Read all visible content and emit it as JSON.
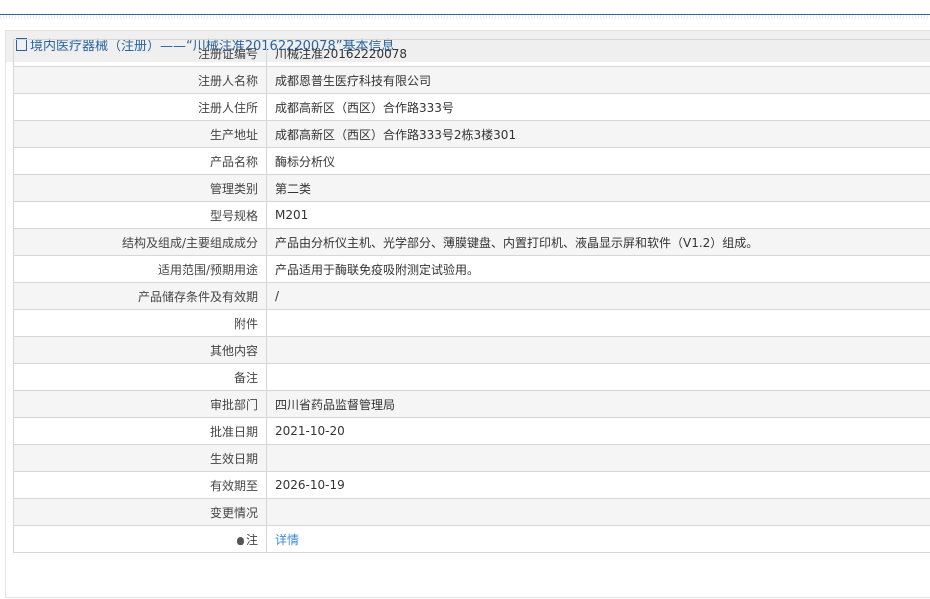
{
  "title": "境内医疗器械（注册）——“川械注准20162220078”基本信息",
  "rows": [
    {
      "label": "注册证编号",
      "value": "川械注准20162220078"
    },
    {
      "label": "注册人名称",
      "value": "成都恩普生医疗科技有限公司"
    },
    {
      "label": "注册人住所",
      "value": "成都高新区（西区）合作路333号"
    },
    {
      "label": "生产地址",
      "value": "成都高新区（西区）合作路333号2栋3楼301"
    },
    {
      "label": "产品名称",
      "value": "酶标分析仪"
    },
    {
      "label": "管理类别",
      "value": "第二类"
    },
    {
      "label": "型号规格",
      "value": "M201"
    },
    {
      "label": "结构及组成/主要组成成分",
      "value": "产品由分析仪主机、光学部分、薄膜键盘、内置打印机、液晶显示屏和软件（V1.2）组成。"
    },
    {
      "label": "适用范围/预期用途",
      "value": "产品适用于酶联免疫吸附测定试验用。"
    },
    {
      "label": "产品储存条件及有效期",
      "value": "/"
    },
    {
      "label": "附件",
      "value": ""
    },
    {
      "label": "其他内容",
      "value": ""
    },
    {
      "label": "备注",
      "value": ""
    },
    {
      "label": "审批部门",
      "value": "四川省药品监督管理局"
    },
    {
      "label": "批准日期",
      "value": "2021-10-20"
    },
    {
      "label": "生效日期",
      "value": ""
    },
    {
      "label": "有效期至",
      "value": "2026-10-19"
    },
    {
      "label": "变更情况",
      "value": ""
    }
  ],
  "note": {
    "label": "注",
    "link": "详情"
  },
  "colors": {
    "accent": "#2a64a0",
    "link": "#3a8ad8"
  }
}
